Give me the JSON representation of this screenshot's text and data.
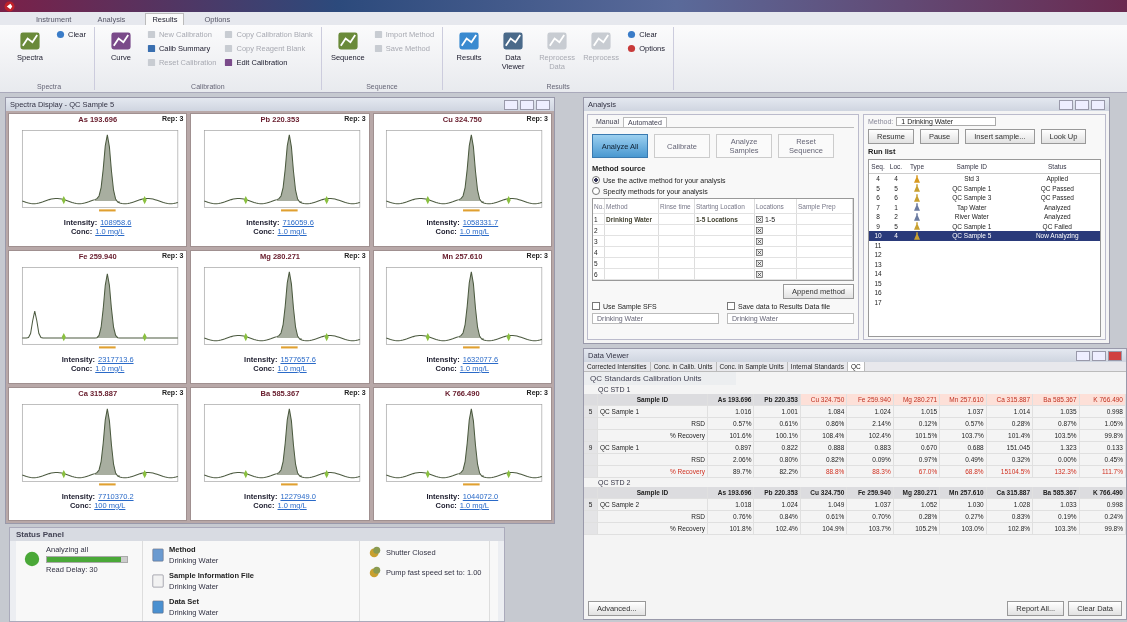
{
  "ribbon": {
    "tabs": [
      {
        "label": "Instrument",
        "selected": false
      },
      {
        "label": "Analysis",
        "selected": false
      },
      {
        "label": "Results",
        "selected": true
      },
      {
        "label": "Options",
        "selected": false
      }
    ],
    "groups": [
      {
        "label": "Spectra",
        "items": [
          {
            "kind": "large",
            "label": "Spectra",
            "disabled": false
          },
          {
            "kind": "small",
            "label": "Clear",
            "disabled": false
          }
        ]
      },
      {
        "label": "Calibration",
        "items": [
          {
            "kind": "large",
            "label": "Curve",
            "disabled": false
          },
          {
            "kind": "small",
            "label": "New Calibration",
            "disabled": true
          },
          {
            "kind": "small",
            "label": "Calib Summary",
            "disabled": false
          },
          {
            "kind": "small",
            "label": "Reset Calibration",
            "disabled": true
          },
          {
            "kind": "small",
            "label": "Copy Calibration Blank",
            "disabled": true
          },
          {
            "kind": "small",
            "label": "Copy Reagent Blank",
            "disabled": true
          },
          {
            "kind": "small",
            "label": "Edit Calibration",
            "disabled": false
          }
        ]
      },
      {
        "label": "Sequence",
        "items": [
          {
            "kind": "large",
            "label": "Sequence",
            "disabled": false
          },
          {
            "kind": "small",
            "label": "Import Method",
            "disabled": true
          },
          {
            "kind": "small",
            "label": "Save Method",
            "disabled": true
          }
        ]
      },
      {
        "label": "Results",
        "items": [
          {
            "kind": "large",
            "label": "Results",
            "disabled": false
          },
          {
            "kind": "small",
            "label": "Clear",
            "disabled": false
          },
          {
            "kind": "small",
            "label": "Options",
            "disabled": false
          },
          {
            "kind": "large",
            "label": "Data Viewer",
            "disabled": false
          },
          {
            "kind": "large",
            "label": "Reprocess Data",
            "disabled": true
          },
          {
            "kind": "large",
            "label": "Reprocess",
            "disabled": true
          }
        ]
      }
    ]
  },
  "spectra": {
    "title": "Spectra Display - QC Sample 5",
    "plots": [
      {
        "title": "As 193.696",
        "rep": "Rep: 3",
        "side_peak": false,
        "intensity_label": "Intensity:",
        "intensity": "108958.6",
        "conc_label": "Conc:",
        "conc": "1.0 mg/L"
      },
      {
        "title": "Pb 220.353",
        "rep": "Rep: 3",
        "side_peak": false,
        "intensity_label": "Intensity:",
        "intensity": "716059.6",
        "conc_label": "Conc:",
        "conc": "1.0 mg/L"
      },
      {
        "title": "Cu 324.750",
        "rep": "Rep: 3",
        "side_peak": false,
        "intensity_label": "Intensity:",
        "intensity": "1058331.7",
        "conc_label": "Conc:",
        "conc": "1.0 mg/L"
      },
      {
        "title": "Fe 259.940",
        "rep": "Rep: 3",
        "side_peak": true,
        "intensity_label": "Intensity:",
        "intensity": "2317713.6",
        "conc_label": "Conc:",
        "conc": "1.0 mg/L"
      },
      {
        "title": "Mg 280.271",
        "rep": "Rep: 3",
        "side_peak": false,
        "intensity_label": "Intensity:",
        "intensity": "1577657.6",
        "conc_label": "Conc:",
        "conc": "1.0 mg/L"
      },
      {
        "title": "Mn 257.610",
        "rep": "Rep: 3",
        "side_peak": false,
        "intensity_label": "Intensity:",
        "intensity": "1632077.6",
        "conc_label": "Conc:",
        "conc": "1.0 mg/L"
      },
      {
        "title": "Ca 315.887",
        "rep": "Rep: 3",
        "side_peak": false,
        "intensity_label": "Intensity:",
        "intensity": "7710370.2",
        "conc_label": "Conc:",
        "conc": "100 mg/L"
      },
      {
        "title": "Ba 585.367",
        "rep": "Rep: 3",
        "side_peak": false,
        "intensity_label": "Intensity:",
        "intensity": "1227949.0",
        "conc_label": "Conc:",
        "conc": "1.0 mg/L"
      },
      {
        "title": "K 766.490",
        "rep": "Rep: 3",
        "side_peak": false,
        "intensity_label": "Intensity:",
        "intensity": "1044072.0",
        "conc_label": "Conc:",
        "conc": "1.0 mg/L"
      }
    ]
  },
  "status_panel": {
    "title": "Status Panel",
    "activity": "Analyzing all",
    "level": 0.92,
    "read_delay": "Read Delay: 30",
    "items": [
      {
        "label": "Method",
        "value": "Drinking Water"
      },
      {
        "label": "Sample Information File",
        "value": "Drinking Water"
      },
      {
        "label": "Data Set",
        "value": "Drinking Water"
      }
    ],
    "instrument": [
      "Shutter Closed",
      "Pump fast speed set to: 1.00"
    ]
  },
  "analysis": {
    "title": "Analysis",
    "tabs": [
      {
        "label": "Manual",
        "selected": false
      },
      {
        "label": "Automated",
        "selected": true
      }
    ],
    "buttons": [
      {
        "label": "Analyze All",
        "selected": true
      },
      {
        "label": "Calibrate",
        "selected": false
      },
      {
        "label": "Analyze Samples",
        "selected": false
      },
      {
        "label": "Reset Sequence",
        "selected": false
      }
    ],
    "method_source": {
      "heading": "Method source",
      "options": [
        {
          "label": "Use the active method for your analysis",
          "selected": true
        },
        {
          "label": "Specify methods for your analysis",
          "selected": false
        }
      ]
    },
    "method_table": {
      "columns": [
        "No.",
        "Method",
        "Rinse time",
        "Starting Location",
        "Locations",
        "Sample Prep"
      ],
      "rows": [
        {
          "no": "1",
          "method": "Drinking Water",
          "start": "1-5 Locations",
          "locations": "1-5"
        },
        {
          "no": "2"
        },
        {
          "no": "3"
        },
        {
          "no": "4"
        },
        {
          "no": "5"
        },
        {
          "no": "6"
        }
      ]
    },
    "append_button": "Append method",
    "options": [
      {
        "label": "Use Sample SFS",
        "checked": false,
        "value": "Drinking Water"
      },
      {
        "label": "Save data to Results Data file",
        "checked": false,
        "value": "Drinking Water"
      }
    ],
    "method_label": "Method:",
    "method_value": "1 Drinking Water",
    "run_buttons": [
      "Resume",
      "Pause",
      "Insert sample...",
      "Look Up"
    ],
    "run_list": {
      "title": "Run list",
      "columns": [
        "Seq.",
        "Loc.",
        "Type",
        "Sample ID",
        "Status"
      ],
      "rows": [
        {
          "seq": "4",
          "loc": "4",
          "kind": "std",
          "sample": "Std 3",
          "status": "Applied",
          "selected": false
        },
        {
          "seq": "5",
          "loc": "5",
          "kind": "qc",
          "sample": "QC Sample 1",
          "status": "QC Passed",
          "selected": false
        },
        {
          "seq": "6",
          "loc": "6",
          "kind": "qc",
          "sample": "QC Sample 3",
          "status": "QC Passed",
          "selected": false
        },
        {
          "seq": "7",
          "loc": "1",
          "kind": "sample",
          "sample": "Tap Water",
          "status": "Analyzed",
          "selected": false
        },
        {
          "seq": "8",
          "loc": "2",
          "kind": "sample",
          "sample": "River Water",
          "status": "Analyzed",
          "selected": false
        },
        {
          "seq": "9",
          "loc": "5",
          "kind": "qc",
          "sample": "QC Sample 1",
          "status": "QC Failed",
          "selected": false
        },
        {
          "seq": "10",
          "loc": "4",
          "kind": "qc",
          "sample": "QC Sample 5",
          "status": "Now Analyzing",
          "selected": true
        },
        {
          "seq": "11"
        },
        {
          "seq": "12"
        },
        {
          "seq": "13"
        },
        {
          "seq": "14"
        },
        {
          "seq": "15"
        },
        {
          "seq": "16"
        },
        {
          "seq": "17"
        }
      ]
    }
  },
  "data_viewer": {
    "title": "Data Viewer",
    "tabs": [
      {
        "label": "Corrected Intensities",
        "selected": false
      },
      {
        "label": "Conc. in Calib. Units",
        "selected": false
      },
      {
        "label": "Conc. in Sample Units",
        "selected": false
      },
      {
        "label": "Internal Standards",
        "selected": false
      },
      {
        "label": "QC",
        "selected": true
      }
    ],
    "section": "QC Standards Calibration Units",
    "groups": [
      {
        "label": "QC STD 1",
        "header": "Sample ID",
        "columns": [
          {
            "label": "As 193.696",
            "flagged": false
          },
          {
            "label": "Pb 220.353",
            "flagged": false
          },
          {
            "label": "Cu 324.750",
            "flagged": true
          },
          {
            "label": "Fe 259.940",
            "flagged": true
          },
          {
            "label": "Mg 280.271",
            "flagged": true
          },
          {
            "label": "Mn 257.610",
            "flagged": true
          },
          {
            "label": "Ca 315.887",
            "flagged": true
          },
          {
            "label": "Ba 585.367",
            "flagged": true
          },
          {
            "label": "K 766.490",
            "flagged": true
          }
        ],
        "rows": [
          {
            "seq": "5",
            "label": "QC Sample 1",
            "kind": "sample",
            "flagged": false,
            "values": [
              "1.016",
              "1.001",
              "1.084",
              "1.024",
              "1.015",
              "1.037",
              "1.014",
              "1.035",
              "0.998"
            ]
          },
          {
            "label": "RSD",
            "kind": "stat",
            "flagged": false,
            "values": [
              "0.57%",
              "0.61%",
              "0.86%",
              "2.14%",
              "0.12%",
              "0.57%",
              "0.28%",
              "0.87%",
              "1.05%"
            ]
          },
          {
            "label": "% Recovery",
            "kind": "stat",
            "flagged": false,
            "values": [
              "101.6%",
              "100.1%",
              "108.4%",
              "102.4%",
              "101.5%",
              "103.7%",
              "101.4%",
              "103.5%",
              "99.8%"
            ]
          },
          {
            "seq": "9",
            "label": "QC Sample 1",
            "kind": "sample",
            "flagged": false,
            "values": [
              "0.897",
              "0.822",
              "0.888",
              "0.883",
              "0.670",
              "0.688",
              "151.045",
              "1.323",
              "0.133"
            ]
          },
          {
            "label": "RSD",
            "kind": "stat",
            "flagged": false,
            "values": [
              "2.06%",
              "0.80%",
              "0.82%",
              "0.09%",
              "0.97%",
              "0.49%",
              "0.32%",
              "0.00%",
              "0.45%"
            ]
          },
          {
            "label": "% Recovery",
            "kind": "stat",
            "flagged": true,
            "values": [
              "89.7%",
              "82.2%",
              "88.8%",
              "88.3%",
              "67.0%",
              "68.8%",
              "15104.5%",
              "132.3%",
              "111.7%"
            ]
          }
        ]
      },
      {
        "label": "QC STD 2",
        "header": "Sample ID",
        "columns": [
          {
            "label": "As 193.696",
            "flagged": false
          },
          {
            "label": "Pb 220.353",
            "flagged": false
          },
          {
            "label": "Cu 324.750",
            "flagged": false
          },
          {
            "label": "Fe 259.940",
            "flagged": false
          },
          {
            "label": "Mg 280.271",
            "flagged": false
          },
          {
            "label": "Mn 257.610",
            "flagged": false
          },
          {
            "label": "Ca 315.887",
            "flagged": false
          },
          {
            "label": "Ba 585.367",
            "flagged": false
          },
          {
            "label": "K 766.490",
            "flagged": false
          }
        ],
        "rows": [
          {
            "seq": "5",
            "label": "QC Sample 2",
            "kind": "sample",
            "flagged": false,
            "values": [
              "1.018",
              "1.024",
              "1.049",
              "1.037",
              "1.052",
              "1.030",
              "1.028",
              "1.033",
              "0.998"
            ]
          },
          {
            "label": "RSD",
            "kind": "stat",
            "flagged": false,
            "values": [
              "0.76%",
              "0.84%",
              "0.61%",
              "0.70%",
              "0.28%",
              "0.27%",
              "0.83%",
              "0.19%",
              "0.24%"
            ]
          },
          {
            "label": "% Recovery",
            "kind": "stat",
            "flagged": false,
            "values": [
              "101.8%",
              "102.4%",
              "104.9%",
              "103.7%",
              "105.2%",
              "103.0%",
              "102.8%",
              "103.3%",
              "99.8%"
            ]
          }
        ]
      }
    ],
    "buttons": {
      "left": "Advanced...",
      "right": [
        "Report All...",
        "Clear Data"
      ]
    }
  }
}
